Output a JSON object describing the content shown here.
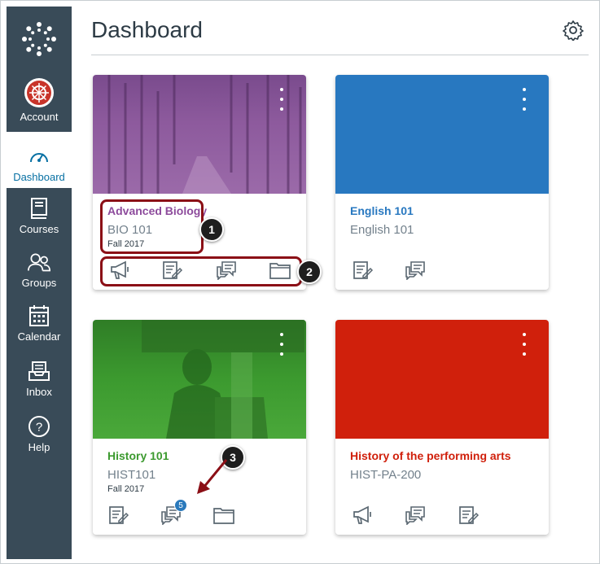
{
  "page": {
    "title": "Dashboard"
  },
  "sidebar": {
    "items": [
      {
        "label": "Account",
        "icon": "account-avatar"
      },
      {
        "label": "Dashboard",
        "icon": "speedometer-icon"
      },
      {
        "label": "Courses",
        "icon": "book-icon"
      },
      {
        "label": "Groups",
        "icon": "groups-icon"
      },
      {
        "label": "Calendar",
        "icon": "calendar-icon"
      },
      {
        "label": "Inbox",
        "icon": "inbox-icon"
      },
      {
        "label": "Help",
        "icon": "help-icon"
      }
    ]
  },
  "cards": [
    {
      "title": "Advanced Biology",
      "code": "BIO 101",
      "term": "Fall 2017",
      "color": "#8d4b9c",
      "actions": [
        "announcements-icon",
        "assignments-icon",
        "discussions-icon",
        "files-icon"
      ]
    },
    {
      "title": "English 101",
      "code": "English 101",
      "term": "",
      "color": "#2878c0",
      "actions": [
        "assignments-icon",
        "discussions-icon"
      ]
    },
    {
      "title": "History 101",
      "code": "HIST101",
      "term": "Fall 2017",
      "color": "#3c9a2f",
      "actions": [
        "assignments-icon",
        "discussions-icon",
        "files-icon"
      ],
      "discussion_badge": "5"
    },
    {
      "title": "History of the performing arts",
      "code": "HIST-PA-200",
      "term": "",
      "color": "#d0200c",
      "actions": [
        "announcements-icon",
        "discussions-icon",
        "assignments-icon"
      ]
    }
  ],
  "callouts": [
    "1",
    "2",
    "3"
  ],
  "colors": {
    "sidebar": "#394b58",
    "active": "#0770a3",
    "callout_border": "#8b0f16"
  }
}
